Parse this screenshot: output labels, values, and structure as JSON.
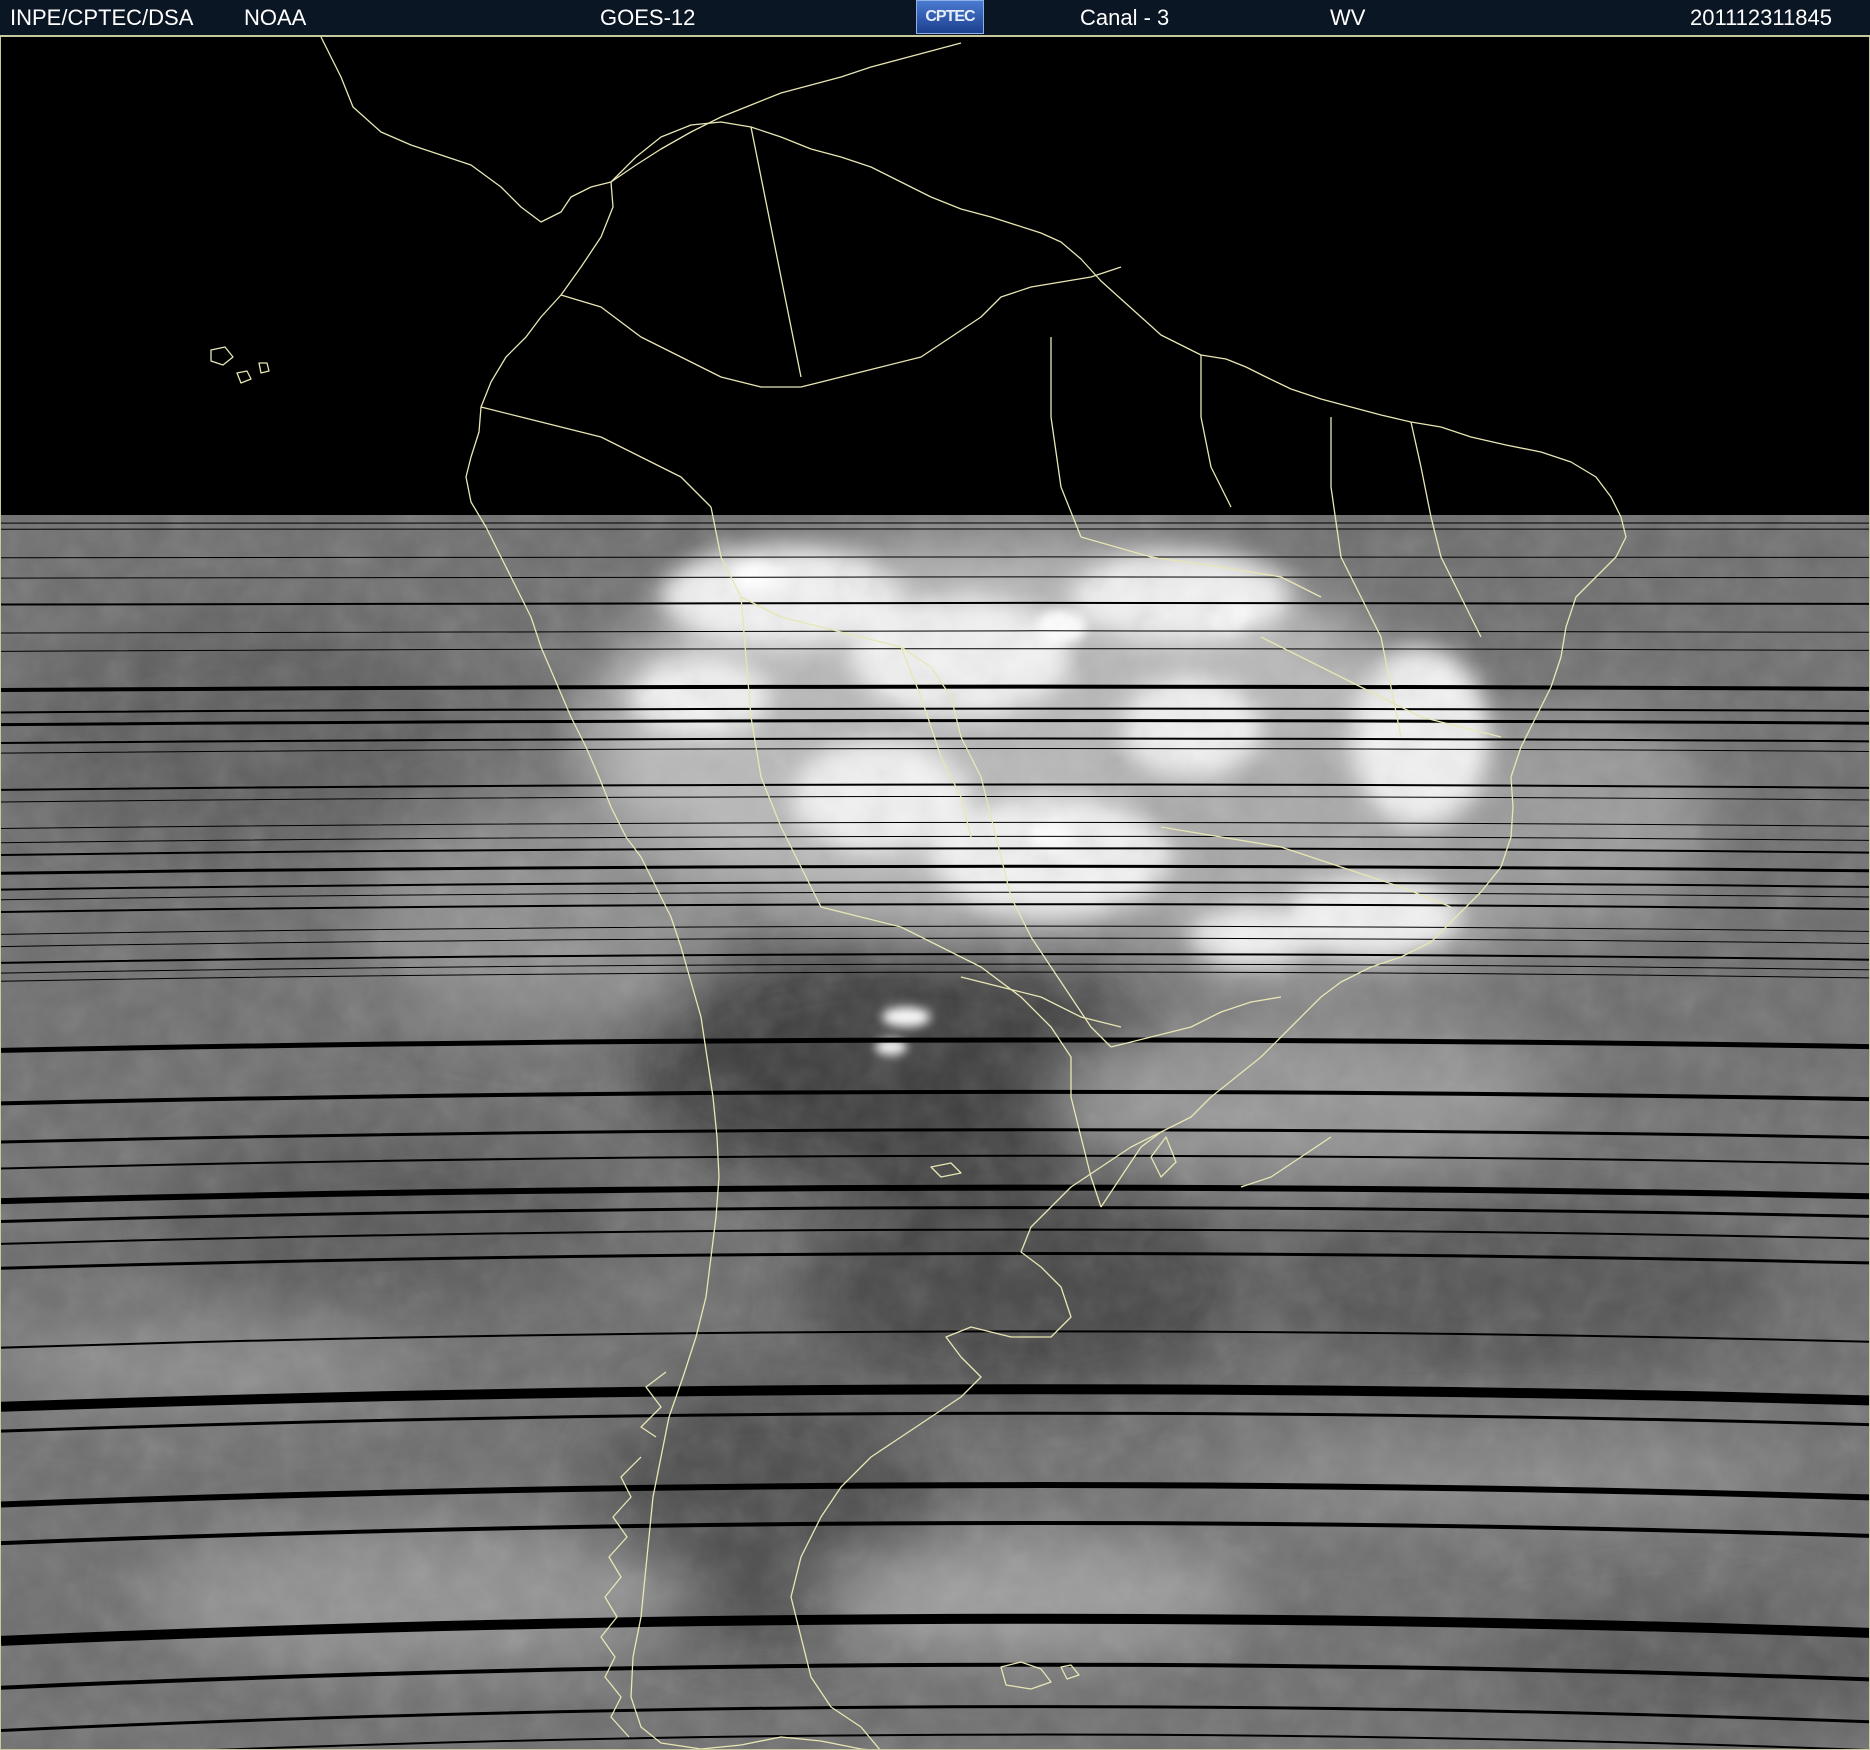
{
  "header": {
    "agency": "INPE/CPTEC/DSA",
    "partner": "NOAA",
    "satellite": "GOES-12",
    "logo_text": "CPTEC",
    "channel": "Canal - 3",
    "band": "WV",
    "timestamp": "201112311845"
  },
  "map": {
    "region": "South America",
    "image_type": "water vapor satellite imagery",
    "colors": {
      "background": "#000000",
      "coastline": "#e8e6b4",
      "header_bg": "#0b1624",
      "header_text": "#ffffff"
    }
  }
}
